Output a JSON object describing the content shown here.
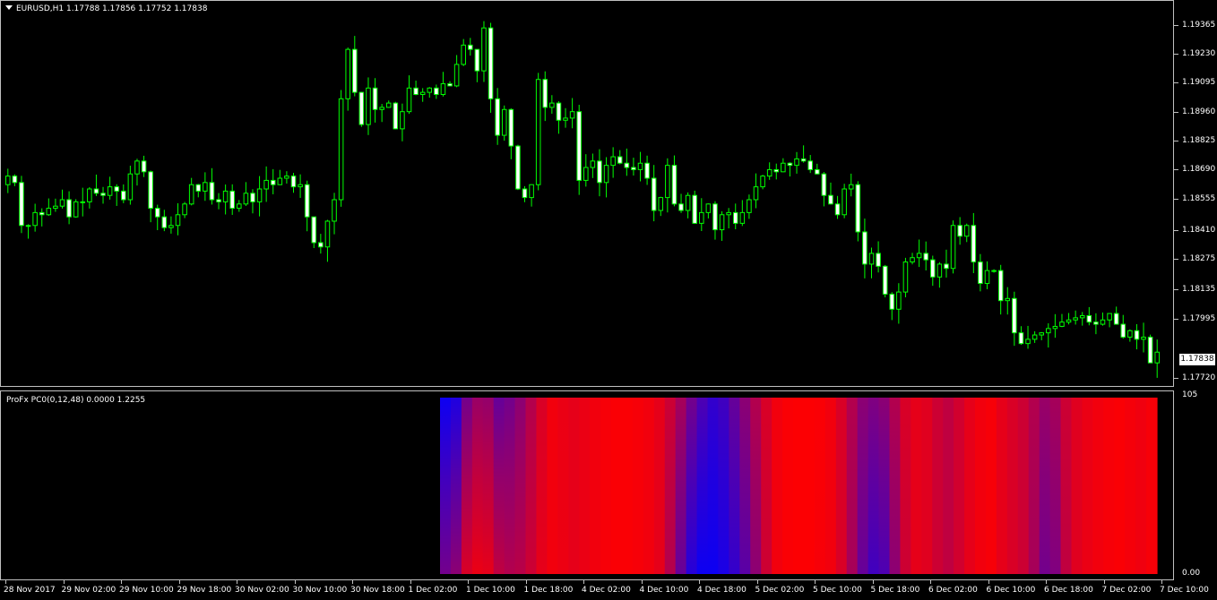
{
  "main": {
    "title": "EURUSD,H1  1.17788 1.17856 1.17752 1.17838",
    "current_price": "1.17838"
  },
  "indicator": {
    "title": "ProFx PC0(0,12,48) 0.0000 1.2255",
    "y_top": "105",
    "y_bottom": "0.00"
  },
  "colors": {
    "bull": "#000000",
    "bear": "#ffffff",
    "outline": "#00ff00",
    "heat_high": "#ff0000",
    "heat_low": "#0000ff"
  },
  "chart_data": [
    {
      "type": "candlestick",
      "title": "EURUSD,H1",
      "yticks": [
        "1.19365",
        "1.19230",
        "1.19095",
        "1.18960",
        "1.18825",
        "1.18690",
        "1.18555",
        "1.18410",
        "1.18275",
        "1.18135",
        "1.17995",
        "1.17720"
      ],
      "ylim": [
        1.17695,
        1.19455
      ],
      "xticks": [
        "28 Nov 2017",
        "29 Nov 02:00",
        "29 Nov 10:00",
        "29 Nov 18:00",
        "30 Nov 02:00",
        "30 Nov 10:00",
        "30 Nov 18:00",
        "1 Dec 02:00",
        "1 Dec 10:00",
        "1 Dec 18:00",
        "4 Dec 02:00",
        "4 Dec 10:00",
        "4 Dec 18:00",
        "5 Dec 02:00",
        "5 Dec 10:00",
        "5 Dec 18:00",
        "6 Dec 02:00",
        "6 Dec 10:00",
        "6 Dec 18:00",
        "7 Dec 02:00",
        "7 Dec 10:00"
      ],
      "close": [
        1.1866,
        1.1863,
        1.1843,
        1.1843,
        1.1849,
        1.1848,
        1.1851,
        1.1852,
        1.1855,
        1.1847,
        1.1854,
        1.1854,
        1.186,
        1.1858,
        1.1857,
        1.1861,
        1.1859,
        1.1855,
        1.1867,
        1.1873,
        1.1868,
        1.1851,
        1.1847,
        1.1842,
        1.1843,
        1.1848,
        1.1853,
        1.1862,
        1.1859,
        1.1863,
        1.1855,
        1.1854,
        1.1859,
        1.1851,
        1.1853,
        1.1858,
        1.1854,
        1.186,
        1.1864,
        1.1862,
        1.1865,
        1.1866,
        1.1861,
        1.1862,
        1.1847,
        1.1835,
        1.1833,
        1.1845,
        1.1855,
        1.1902,
        1.1925,
        1.1905,
        1.189,
        1.1907,
        1.1897,
        1.1898,
        1.19,
        1.1888,
        1.1896,
        1.1907,
        1.1904,
        1.1905,
        1.1907,
        1.1904,
        1.1909,
        1.1908,
        1.1918,
        1.1927,
        1.1925,
        1.1915,
        1.1935,
        1.1902,
        1.1885,
        1.1897,
        1.188,
        1.186,
        1.1856,
        1.1862,
        1.1911,
        1.1898,
        1.19,
        1.1892,
        1.1893,
        1.1896,
        1.1864,
        1.187,
        1.1873,
        1.1863,
        1.1871,
        1.1875,
        1.1872,
        1.187,
        1.1869,
        1.1872,
        1.1865,
        1.185,
        1.1856,
        1.1871,
        1.1853,
        1.185,
        1.1857,
        1.1844,
        1.1849,
        1.1853,
        1.1841,
        1.1848,
        1.1849,
        1.1844,
        1.1849,
        1.1855,
        1.1861,
        1.1866,
        1.1869,
        1.1868,
        1.1872,
        1.1871,
        1.1874,
        1.1873,
        1.1869,
        1.1867,
        1.1857,
        1.1853,
        1.1848,
        1.186,
        1.1862,
        1.184,
        1.1825,
        1.183,
        1.1824,
        1.1811,
        1.1804,
        1.1812,
        1.1826,
        1.1828,
        1.183,
        1.1827,
        1.1819,
        1.1825,
        1.1823,
        1.1843,
        1.1838,
        1.1843,
        1.1826,
        1.1816,
        1.1822,
        1.1822,
        1.1808,
        1.1809,
        1.1793,
        1.1788,
        1.179,
        1.1792,
        1.1793,
        1.1795,
        1.1796,
        1.1798,
        1.1799,
        1.18,
        1.1801,
        1.1798,
        1.1797,
        1.1799,
        1.1802,
        1.1797,
        1.1791,
        1.1794,
        1.179,
        1.1791,
        1.1779,
        1.1784
      ]
    },
    {
      "type": "heatmap",
      "title": "ProFx PC0(0,12,48)",
      "ylim": [
        0,
        105
      ],
      "columns": [
        0.05,
        0.12,
        0.45,
        0.6,
        0.58,
        0.4,
        0.45,
        0.55,
        0.7,
        0.85,
        0.95,
        0.92,
        0.9,
        0.92,
        0.95,
        0.97,
        0.98,
        0.98,
        0.97,
        0.95,
        0.9,
        0.8,
        0.65,
        0.45,
        0.3,
        0.2,
        0.25,
        0.4,
        0.55,
        0.7,
        0.85,
        0.95,
        0.98,
        0.99,
        0.99,
        0.98,
        0.95,
        0.85,
        0.7,
        0.55,
        0.5,
        0.55,
        0.7,
        0.85,
        0.9,
        0.88,
        0.8,
        0.75,
        0.82,
        0.9,
        0.95,
        0.97,
        0.9,
        0.85,
        0.8,
        0.7,
        0.6,
        0.65,
        0.8,
        0.88,
        0.92,
        0.95,
        0.97,
        0.98,
        0.96,
        0.94,
        0.97
      ],
      "low_column_bottom": [
        0.45,
        0.55,
        0.85,
        0.92,
        0.9,
        0.75,
        0.7,
        0.72,
        0.8,
        0.9,
        0.95,
        0.93,
        0.9,
        0.92,
        0.95,
        0.97,
        0.98,
        0.98,
        0.97,
        0.95,
        0.9,
        0.7,
        0.4,
        0.15,
        0.05,
        0.05,
        0.1,
        0.2,
        0.35,
        0.55,
        0.8,
        0.95,
        0.98,
        0.99,
        0.99,
        0.97,
        0.95,
        0.85,
        0.65,
        0.4,
        0.25,
        0.3,
        0.55,
        0.8,
        0.9,
        0.88,
        0.8,
        0.75,
        0.82,
        0.9,
        0.95,
        0.97,
        0.9,
        0.85,
        0.8,
        0.65,
        0.45,
        0.5,
        0.75,
        0.88,
        0.92,
        0.95,
        0.97,
        0.98,
        0.96,
        0.94,
        0.97
      ]
    }
  ]
}
